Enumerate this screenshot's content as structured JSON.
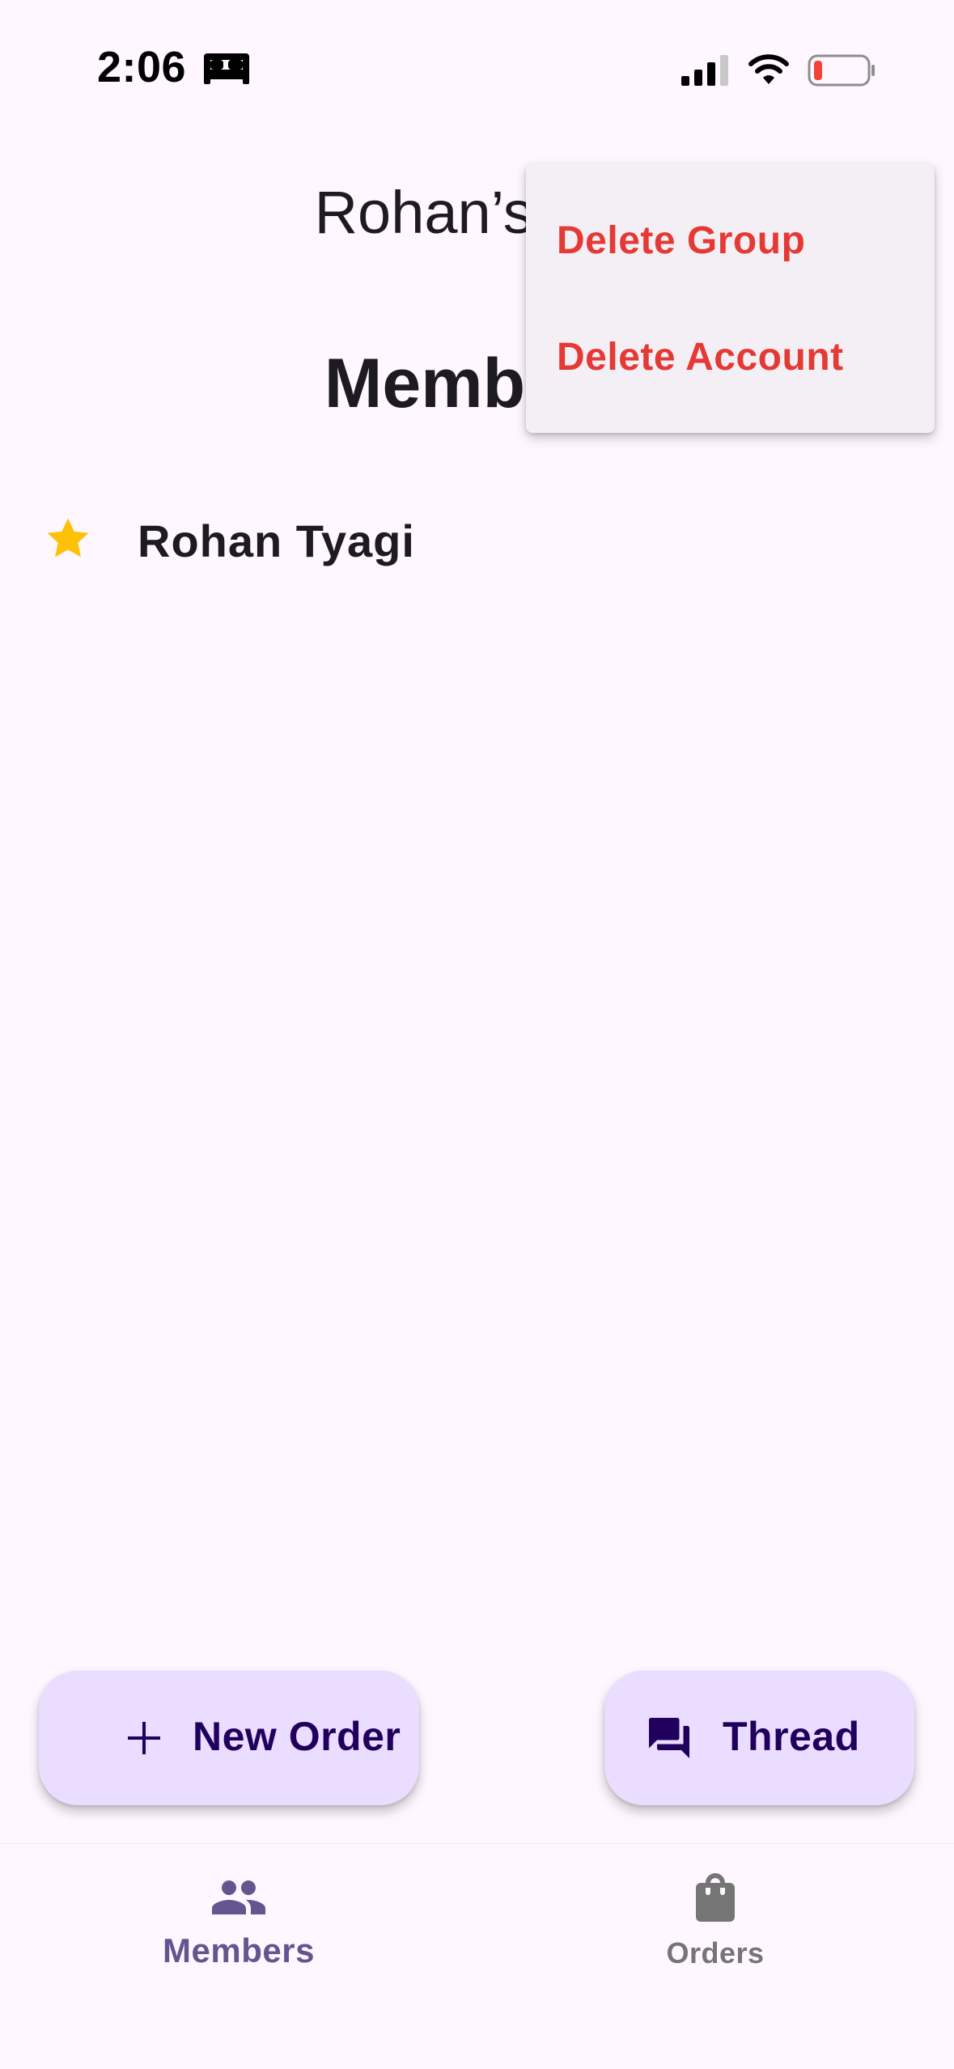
{
  "status_bar": {
    "time": "2:06",
    "icons": [
      "bed-icon",
      "cellular-signal-icon",
      "wifi-icon",
      "battery-low-icon"
    ],
    "battery_color": "#F44336"
  },
  "header": {
    "group_title": "Rohan’s Rig",
    "page_title": "Members"
  },
  "members": [
    {
      "name": "Rohan Tyagi",
      "icon": "star-icon",
      "icon_color": "#FFC107"
    }
  ],
  "menu": {
    "items": [
      {
        "label": "Delete Group"
      },
      {
        "label": "Delete Account"
      }
    ],
    "item_color": "#E53935"
  },
  "actions": {
    "new_order": {
      "label": "New Order",
      "icon": "plus-icon"
    },
    "thread": {
      "label": "Thread",
      "icon": "forum-icon"
    }
  },
  "bottom_nav": {
    "items": [
      {
        "label": "Members",
        "icon": "group-icon",
        "selected": true,
        "color": "#65558F"
      },
      {
        "label": "Orders",
        "icon": "shopping-bag-icon",
        "selected": false,
        "color": "#757575"
      }
    ]
  },
  "colors": {
    "background": "#FEF7FF",
    "fab_background": "#EADDFF",
    "fab_text": "#21005D",
    "menu_background": "#F3EFF4"
  }
}
